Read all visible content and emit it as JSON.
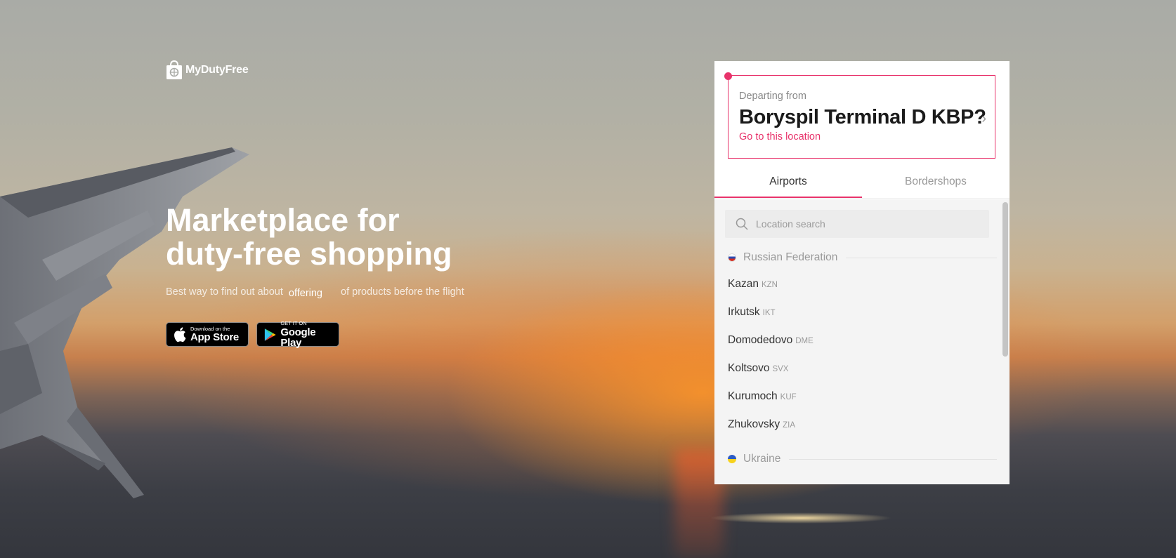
{
  "brand": {
    "name": "MyDutyFree"
  },
  "hero": {
    "title_line1": "Marketplace for",
    "title_line2": "duty-free shopping",
    "subtitle_pre": "Best way to find out about",
    "subtitle_highlight": "offering",
    "subtitle_post": "of products before the flight"
  },
  "stores": {
    "apple_small": "Download on the",
    "apple_big": "App Store",
    "google_small": "GET IT ON",
    "google_big": "Google Play"
  },
  "departure": {
    "label": "Departing from",
    "location": "Boryspil Terminal D KBP?",
    "link": "Go to this location"
  },
  "tabs": [
    {
      "label": "Airports",
      "active": true
    },
    {
      "label": "Bordershops",
      "active": false
    }
  ],
  "search": {
    "placeholder": "Location search",
    "value": ""
  },
  "countries": [
    {
      "name": "Russian Federation",
      "airports": [
        {
          "name": "Kazan",
          "code": "KZN"
        },
        {
          "name": "Irkutsk",
          "code": "IKT"
        },
        {
          "name": "Domodedovo",
          "code": "DME"
        },
        {
          "name": "Koltsovo",
          "code": "SVX"
        },
        {
          "name": "Kurumoch",
          "code": "KUF"
        },
        {
          "name": "Zhukovsky",
          "code": "ZIA"
        }
      ]
    },
    {
      "name": "Ukraine",
      "airports": []
    }
  ],
  "colors": {
    "accent": "#e8336b",
    "text": "#1b1b1b",
    "muted": "#9a9a9a"
  }
}
